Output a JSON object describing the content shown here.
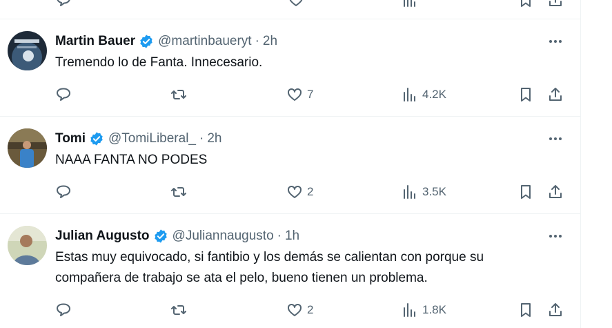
{
  "tweets": [
    {
      "name": "Martin Bauer",
      "handle": "@martinbaueryt",
      "time": "2h",
      "text": [
        "Tremendo lo de Fanta. Innecesario."
      ],
      "likes": "7",
      "views": "4.2K"
    },
    {
      "name": "Tomi",
      "handle": "@TomiLiberal_",
      "time": "2h",
      "text": [
        "NAAA FANTA NO PODES"
      ],
      "likes": "2",
      "views": "3.5K"
    },
    {
      "name": "Julian Augusto",
      "handle": "@Juliannaugusto",
      "time": "1h",
      "text": [
        "Estas muy equivocado, si fantibio y los demás se calientan con porque su",
        "compañera de trabajo se ata el pelo, bueno tienen un problema."
      ],
      "likes": "2",
      "views": "1.8K"
    }
  ],
  "colors": {
    "verified": "#1d9bf0",
    "muted": "#536471",
    "text": "#0f1419"
  },
  "icons": [
    "reply-icon",
    "retweet-icon",
    "like-icon",
    "views-icon",
    "bookmark-icon",
    "share-icon",
    "more-icon",
    "verified-badge-icon"
  ]
}
